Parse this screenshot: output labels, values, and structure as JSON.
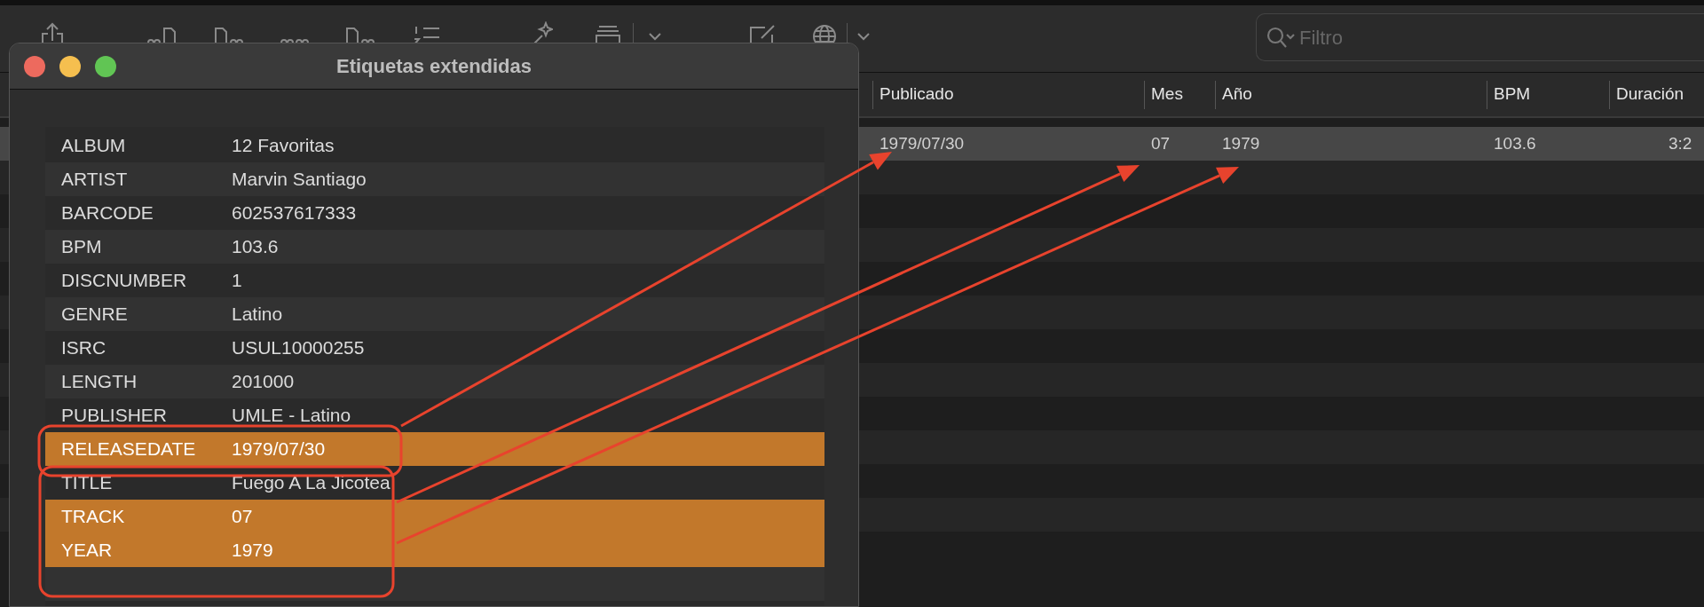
{
  "toolbar": {
    "search": {
      "placeholder": "Filtro"
    }
  },
  "track_list": {
    "columns": [
      "Publicado",
      "Mes",
      "Año",
      "BPM",
      "Duración"
    ],
    "rows": [
      {
        "cells": [
          "1979/07/30",
          "07",
          "1979",
          "103.6",
          "3:2"
        ],
        "selected": true
      }
    ]
  },
  "dialog": {
    "title": "Etiquetas extendidas",
    "tags": [
      {
        "key": "ALBUM",
        "value": "12 Favoritas",
        "highlighted": false
      },
      {
        "key": "ARTIST",
        "value": "Marvin Santiago",
        "highlighted": false
      },
      {
        "key": "BARCODE",
        "value": "602537617333",
        "highlighted": false
      },
      {
        "key": "BPM",
        "value": "103.6",
        "highlighted": false
      },
      {
        "key": "DISCNUMBER",
        "value": "1",
        "highlighted": false
      },
      {
        "key": "GENRE",
        "value": "Latino",
        "highlighted": false
      },
      {
        "key": "ISRC",
        "value": "USUL10000255",
        "highlighted": false
      },
      {
        "key": "LENGTH",
        "value": "201000",
        "highlighted": false
      },
      {
        "key": "PUBLISHER",
        "value": "UMLE - Latino",
        "highlighted": false
      },
      {
        "key": "RELEASEDATE",
        "value": "1979/07/30",
        "highlighted": true
      },
      {
        "key": "TITLE",
        "value": "Fuego A La Jicotea",
        "highlighted": false
      },
      {
        "key": "TRACK",
        "value": "07",
        "highlighted": true
      },
      {
        "key": "YEAR",
        "value": "1979",
        "highlighted": true
      }
    ]
  }
}
